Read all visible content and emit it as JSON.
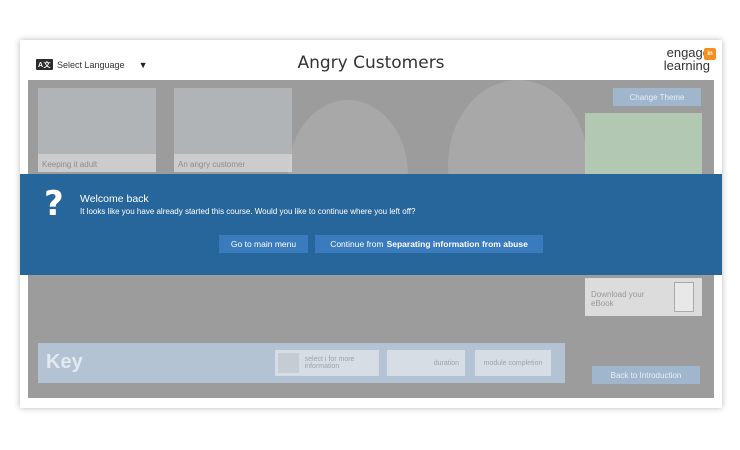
{
  "header": {
    "language_icon_text": "A文",
    "language_label": "Select Language",
    "language_caret": "▼",
    "title": "Angry Customers",
    "logo_line1": "engage",
    "logo_line2": "learning",
    "logo_badge": "in"
  },
  "background": {
    "theme_button": "Change Theme",
    "thumbnails": [
      {
        "label": "Keeping it adult"
      },
      {
        "label": "An angry customer"
      }
    ],
    "ebook_label": "Download your eBook",
    "key": {
      "title": "Key",
      "info_text": "select i for more information",
      "duration_text": "duration",
      "completion_text": "module completion"
    },
    "back_button": "Back to Introduction"
  },
  "modal": {
    "icon": "?",
    "title": "Welcome back",
    "message": "It looks like you have already started this course. Would you like to continue where you left off?",
    "menu_button": "Go to main menu",
    "continue_prefix": "Continue from",
    "continue_target": "Separating information from abuse"
  },
  "colors": {
    "modal_bg": "#26669a",
    "button_bg": "#3a7bbd",
    "overlay": "#9c9c9c"
  }
}
